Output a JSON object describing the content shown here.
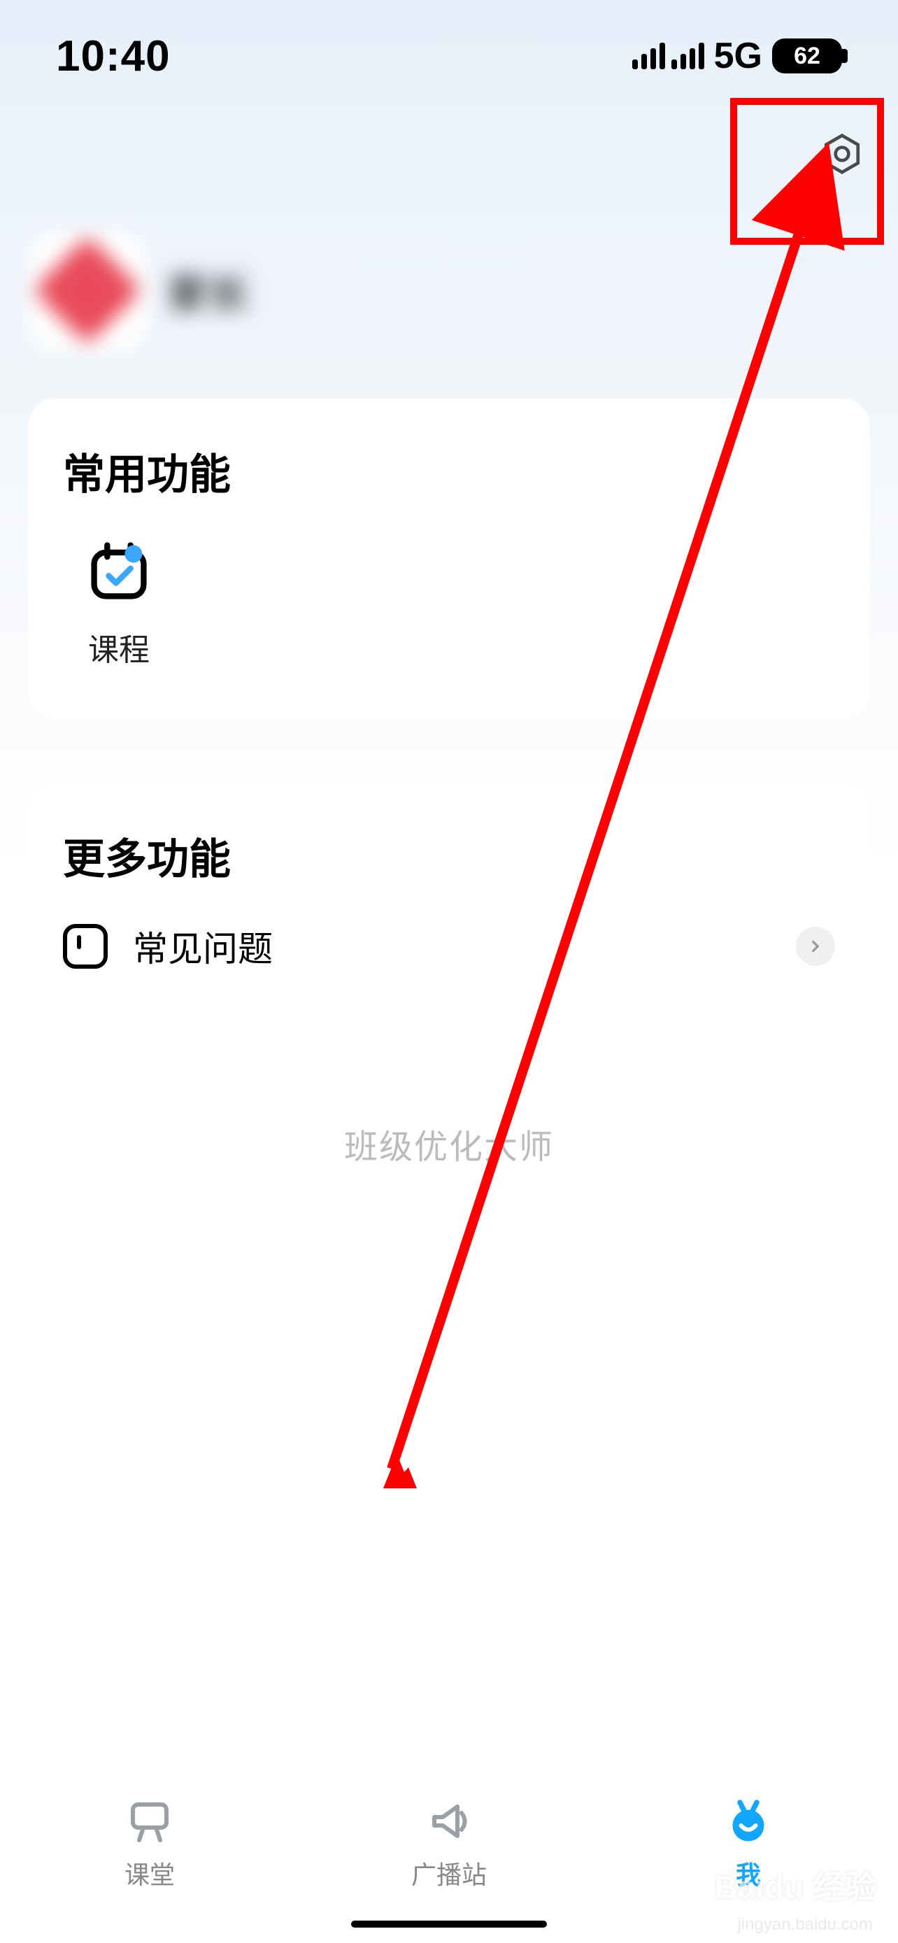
{
  "status": {
    "time": "10:40",
    "network": "5G",
    "battery": "62"
  },
  "profile": {
    "name": "家长"
  },
  "sections": {
    "common": {
      "title": "常用功能",
      "items": [
        {
          "label": "课程",
          "icon": "calendar-check-icon"
        }
      ]
    },
    "more": {
      "title": "更多功能",
      "items": [
        {
          "label": "常见问题",
          "icon": "faq-icon"
        }
      ]
    }
  },
  "brand": "班级优化大师",
  "nav": {
    "items": [
      {
        "label": "课堂",
        "icon": "classroom-icon",
        "active": false
      },
      {
        "label": "广播站",
        "icon": "broadcast-icon",
        "active": false
      },
      {
        "label": "我",
        "icon": "me-icon",
        "active": true
      }
    ]
  },
  "watermark": {
    "main": "Baidu 经验",
    "sub": "jingyan.baidu.com"
  },
  "annotation": {
    "target": "settings-icon",
    "type": "arrow-highlight"
  }
}
